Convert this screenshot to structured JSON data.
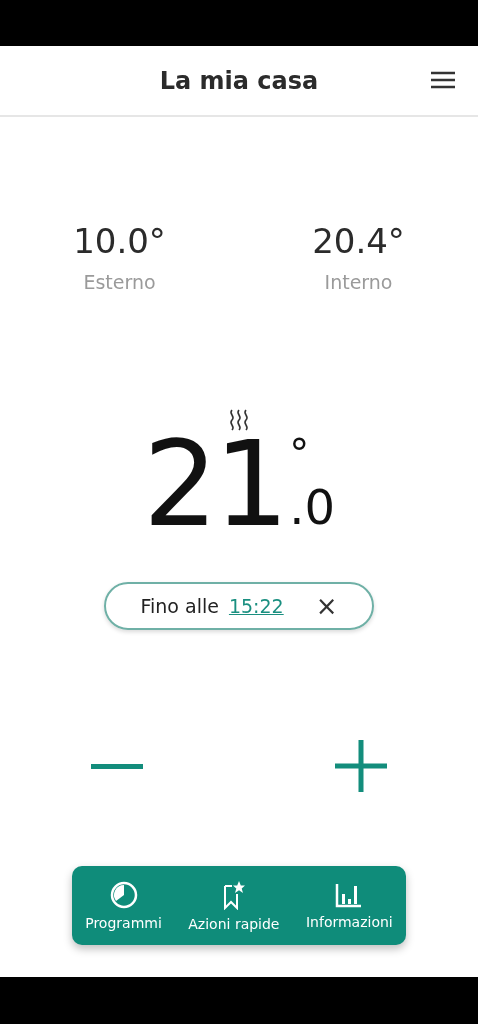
{
  "header": {
    "title": "La mia casa"
  },
  "readings": [
    {
      "value": "10.0°",
      "label": "Esterno"
    },
    {
      "value": "20.4°",
      "label": "Interno"
    }
  ],
  "setpoint": {
    "heating": true,
    "whole": "21",
    "decimal": ".0",
    "degree": "°"
  },
  "override": {
    "prefix": "Fino alle",
    "time": "15:22",
    "close": "×"
  },
  "bottom_nav": [
    {
      "kind": "programs",
      "label": "Programmi"
    },
    {
      "kind": "quick",
      "label": "Azioni rapide"
    },
    {
      "kind": "info",
      "label": "Informazioni"
    }
  ]
}
